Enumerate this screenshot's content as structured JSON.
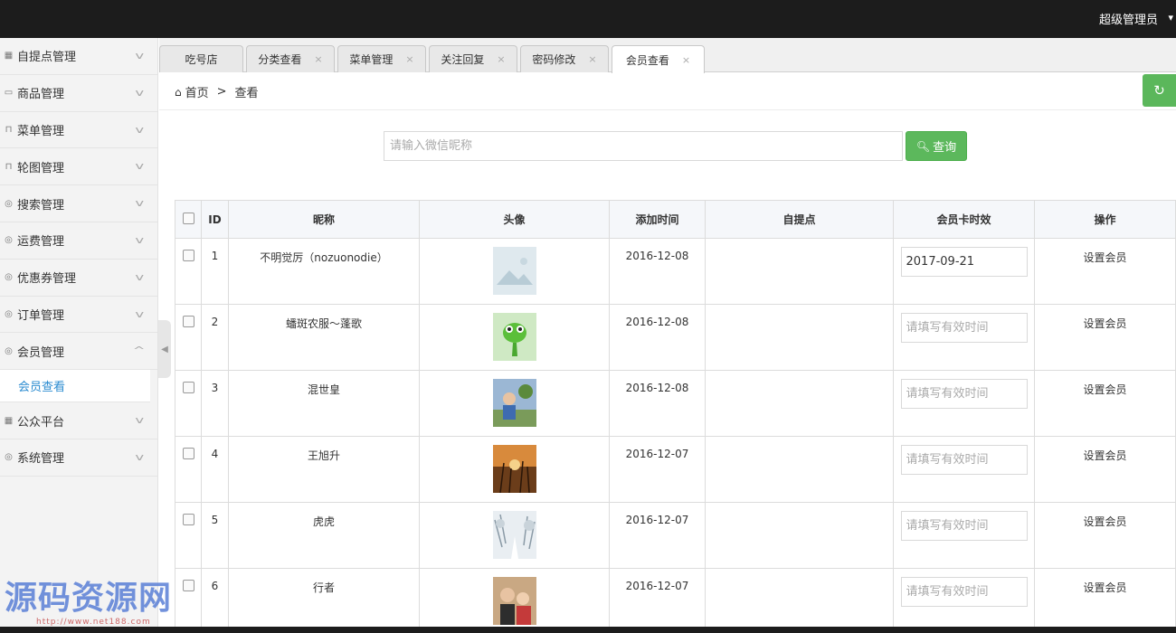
{
  "topbar": {
    "user_label": "超级管理员"
  },
  "sidebar": {
    "items": [
      {
        "label": "自提点管理",
        "icon": "building-icon"
      },
      {
        "label": "商品管理",
        "icon": "image-icon"
      },
      {
        "label": "菜单管理",
        "icon": "bag-icon"
      },
      {
        "label": "轮图管理",
        "icon": "bag-icon"
      },
      {
        "label": "搜索管理",
        "icon": "chat-icon"
      },
      {
        "label": "运费管理",
        "icon": "chat-icon"
      },
      {
        "label": "优惠券管理",
        "icon": "chat-icon"
      },
      {
        "label": "订单管理",
        "icon": "chat-icon"
      },
      {
        "label": "会员管理",
        "icon": "chat-icon",
        "expanded": true
      },
      {
        "label": "公众平台",
        "icon": "building-icon"
      },
      {
        "label": "系统管理",
        "icon": "chat-icon"
      }
    ],
    "sub_item": "会员查看"
  },
  "tabs": [
    {
      "label": "吃号店",
      "closable": false
    },
    {
      "label": "分类查看",
      "closable": true
    },
    {
      "label": "菜单管理",
      "closable": true
    },
    {
      "label": "关注回复",
      "closable": true
    },
    {
      "label": "密码修改",
      "closable": true
    },
    {
      "label": "会员查看",
      "closable": true,
      "active": true
    }
  ],
  "tab_close": "×",
  "breadcrumb": {
    "home": "首页",
    "sep": ">",
    "current": "查看"
  },
  "search": {
    "placeholder": "请输入微信昵称",
    "button_label": "查询"
  },
  "table": {
    "headers": {
      "id": "ID",
      "nickname": "昵称",
      "avatar": "头像",
      "added": "添加时间",
      "pickup": "自提点",
      "expiry": "会员卡时效",
      "action": "操作"
    },
    "expiry_placeholder": "请填写有效时间",
    "rows": [
      {
        "id": "1",
        "nickname": "不明觉厉（nozuonodie）",
        "added": "2016-12-08",
        "pickup": "",
        "expiry": "2017-09-21",
        "action": "设置会员"
      },
      {
        "id": "2",
        "nickname": "蟠斑农服～蓬歌",
        "added": "2016-12-08",
        "pickup": "",
        "expiry": "",
        "action": "设置会员"
      },
      {
        "id": "3",
        "nickname": "混世皇",
        "added": "2016-12-08",
        "pickup": "",
        "expiry": "",
        "action": "设置会员"
      },
      {
        "id": "4",
        "nickname": "王旭升",
        "added": "2016-12-07",
        "pickup": "",
        "expiry": "",
        "action": "设置会员"
      },
      {
        "id": "5",
        "nickname": "虎虎",
        "added": "2016-12-07",
        "pickup": "",
        "expiry": "",
        "action": "设置会员"
      },
      {
        "id": "6",
        "nickname": "行者",
        "added": "2016-12-07",
        "pickup": "",
        "expiry": "",
        "action": "设置会员"
      }
    ]
  },
  "watermark": {
    "text": "源码资源网",
    "url": "http://www.net188.com"
  },
  "colors": {
    "accent_green": "#5cb85c",
    "topbar": "#1c1c1c",
    "active_sub": "#2a8bd0"
  }
}
